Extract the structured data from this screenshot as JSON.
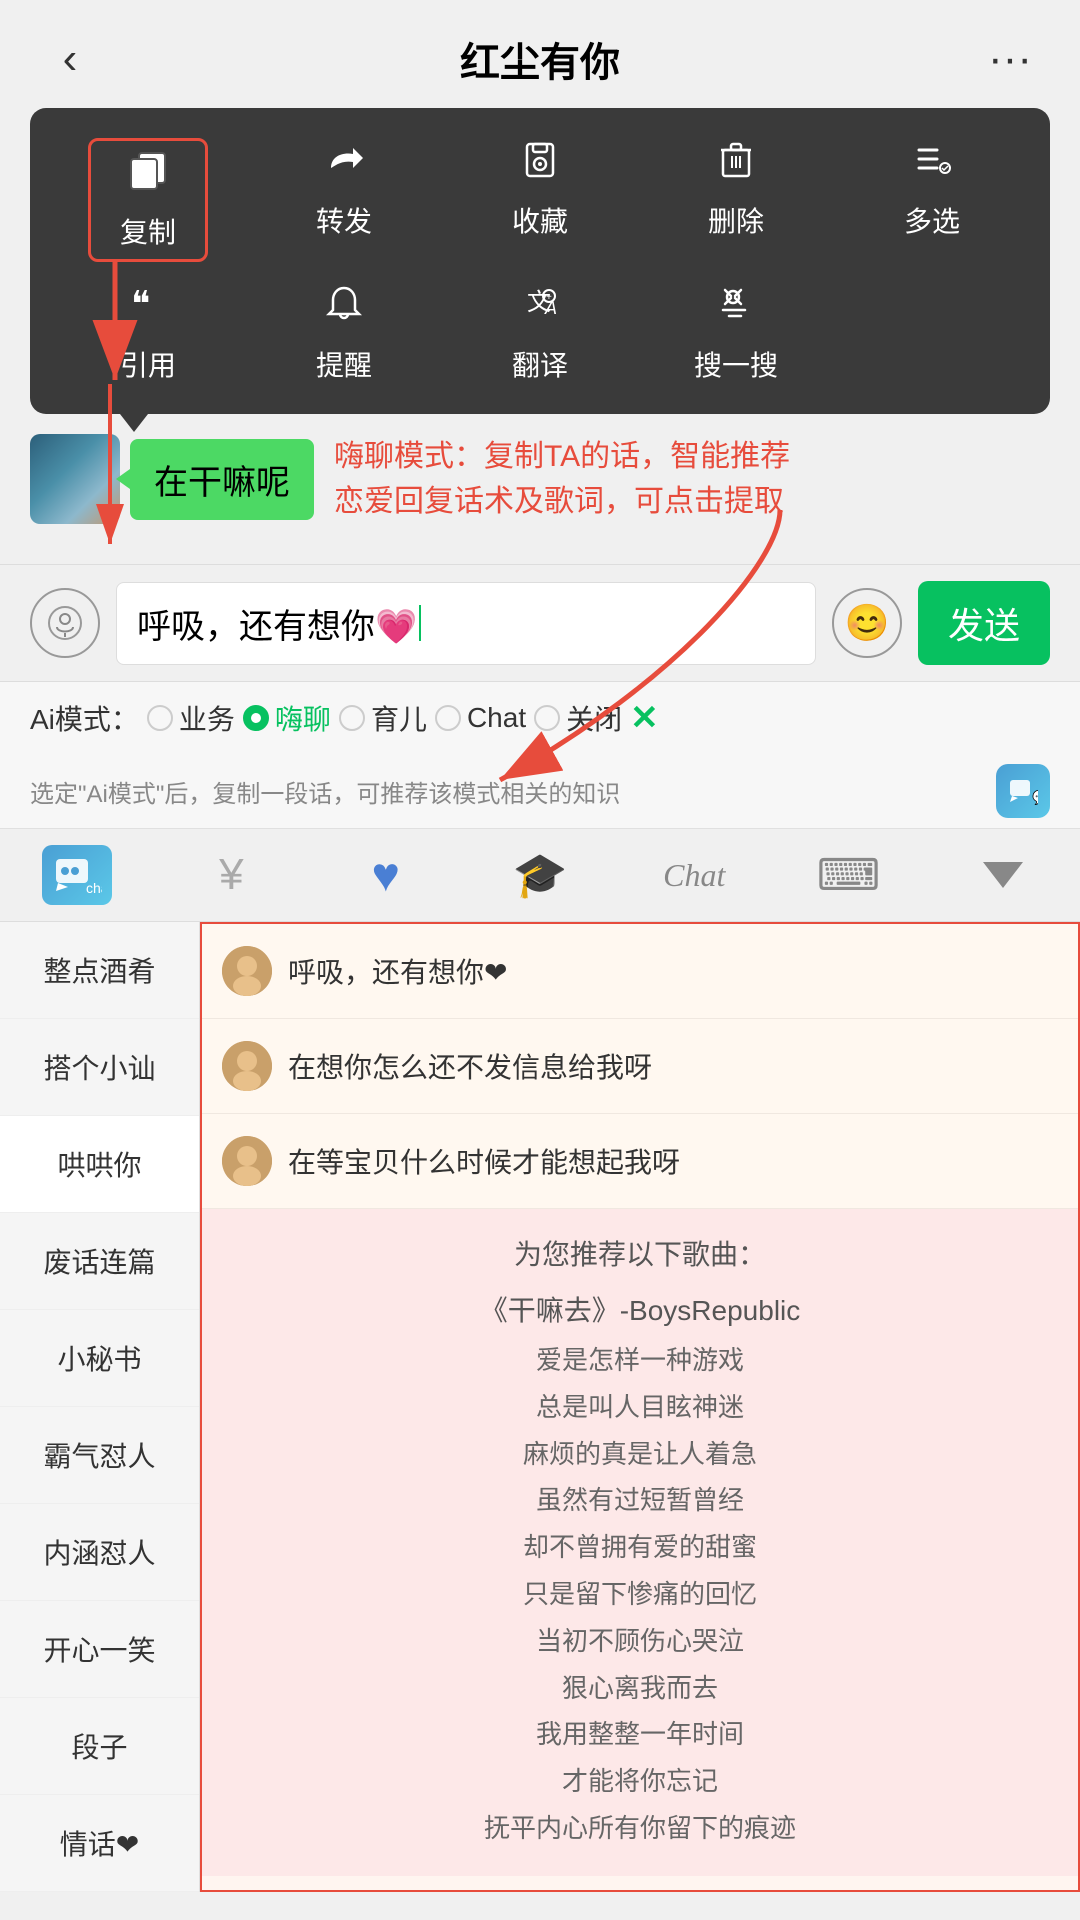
{
  "header": {
    "title": "红尘有你",
    "back_icon": "‹",
    "more_icon": "···"
  },
  "context_menu": {
    "row1": [
      {
        "icon": "📄",
        "label": "复制",
        "highlighted": true
      },
      {
        "icon": "↪",
        "label": "转发"
      },
      {
        "icon": "🎁",
        "label": "收藏"
      },
      {
        "icon": "🗑",
        "label": "删除"
      },
      {
        "icon": "☰",
        "label": "多选"
      }
    ],
    "row2": [
      {
        "icon": "❝",
        "label": "引用"
      },
      {
        "icon": "🔔",
        "label": "提醒"
      },
      {
        "icon": "A",
        "label": "翻译"
      },
      {
        "icon": "✳",
        "label": "搜一搜"
      }
    ]
  },
  "annotation": {
    "chat_bubble": "在干嘛呢",
    "hint_text": "嗨聊模式：复制TA的话，智能推荐\n恋爱回复话术及歌词，可点击提取"
  },
  "input_bar": {
    "text": "呼吸，还有想你💗",
    "send_label": "发送"
  },
  "ai_mode": {
    "label": "Ai模式：",
    "options": [
      "业务",
      "嗨聊",
      "育儿",
      "Chat",
      "关闭"
    ],
    "active": "嗨聊"
  },
  "info_row": {
    "text": "选定\"Ai模式\"后，复制一段话，可推荐该模式相关的知识"
  },
  "toolbar": {
    "items": [
      "chat_robot",
      "yuan",
      "heart",
      "graduation",
      "chat",
      "keyboard"
    ],
    "chat_label": "chat",
    "collapse_label": "▼"
  },
  "sidebar": {
    "items": [
      "整点酒肴",
      "搭个小讪",
      "哄哄你",
      "废话连篇",
      "小秘书",
      "霸气怼人",
      "内涵怼人",
      "开心一笑",
      "段子",
      "情话❤"
    ]
  },
  "replies": [
    "呼吸，还有想你❤",
    "在想你怎么还不发信息给我呀",
    "在等宝贝什么时候才能想起我呀"
  ],
  "songs": {
    "header": "为您推荐以下歌曲：",
    "list": [
      "《干嘛去》-BoysRepublic",
      "爱是怎样一种游戏",
      "总是叫人目眩神迷",
      "麻烦的真是让人着急",
      "虽然有过短暂曾经",
      "却不曾拥有爱的甜蜜",
      "只是留下惨痛的回忆",
      "当初不顾伤心哭泣",
      "狠心离我而去",
      "我用整整一年时间",
      "才能将你忘记",
      "抚平内心所有你留下的痕迹"
    ]
  }
}
